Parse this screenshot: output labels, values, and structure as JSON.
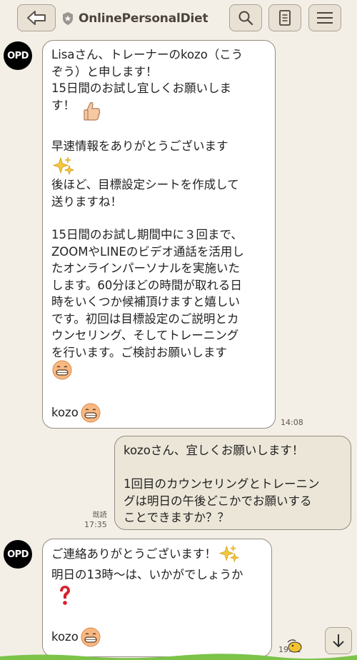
{
  "header": {
    "title": "OnlinePersonalDiet"
  },
  "avatar_label": "OPD",
  "messages": [
    {
      "sender": "kozo",
      "lines_1": "Lisaさん、トレーナーのkozo（こう\nぞう）と申します！\n15日間のお試し宜しくお願いしま\nす！",
      "lines_2": "早速情報をありがとうございます",
      "lines_3": "後ほど、目標設定シートを作成して\n送りますね！",
      "lines_4": "15日間のお試し期間中に３回まで、\nZOOMやLINEのビデオ通話を活用し\nたオンラインパーソナルを実施いた\nします。60分ほどの時間が取れる日\n時をいくつか候補頂けますと嬉しい\nです。初回は目標設定のご説明とカ\nウンセリング、そしてトレーニング\nを行います。ご検討お願いします",
      "signature": "kozo",
      "time": "14:08"
    },
    {
      "sender": "Lisa",
      "text": "kozoさん、宜しくお願いします！\n\n1回目のカウンセリングとトレーニン\nグは明日の午後どこかでお願いする\nことできますか？？",
      "read_label": "既読",
      "time": "17:35"
    },
    {
      "sender": "kozo",
      "line_1": "ご連絡ありがとうございます！",
      "line_2": "明日の13時〜は、いかがでしょうか",
      "signature": "kozo",
      "time": "19:11"
    }
  ]
}
